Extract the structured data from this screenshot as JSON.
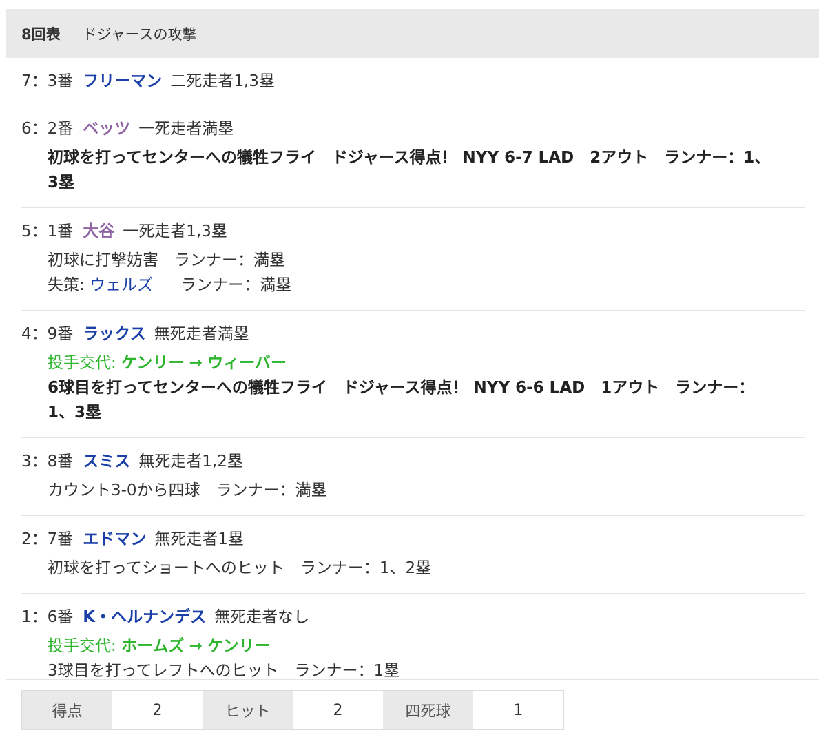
{
  "header": {
    "inning": "8回表",
    "attack": "ドジャースの攻撃"
  },
  "colors": {
    "player_blue": "#1a3fa8",
    "player_purple": "#8f63a3",
    "change_green": "#2db52d"
  },
  "plays": [
    {
      "num": "7：3番",
      "name": "フリーマン",
      "situation": "二死走者1,3塁"
    },
    {
      "num": "6：2番",
      "name": "ベッツ",
      "situation": "一死走者満塁",
      "result_line1": "初球を打ってセンターへの犠牲フライ　ドジャース得点！ NYY 6-7 LAD　2アウト　ランナー：1、",
      "result_line2": "3塁"
    },
    {
      "num": "5：1番",
      "name": "大谷",
      "situation": "一死走者1,3塁",
      "result": "初球に打撃妨害　ランナー：満塁",
      "error_prefix": "失策: ",
      "error_player": "ウェルズ",
      "error_runner": "ランナー：満塁"
    },
    {
      "num": "4：9番",
      "name": "ラックス",
      "situation": "無死走者満塁",
      "change_prefix": "投手交代: ",
      "change_from": "ケンリー",
      "change_arrow": " → ",
      "change_to": "ウィーバー",
      "result_line1": "6球目を打ってセンターへの犠牲フライ　ドジャース得点！ NYY 6-6 LAD　1アウト　ランナー：",
      "result_line2": "1、3塁"
    },
    {
      "num": "3：8番",
      "name": "スミス",
      "situation": "無死走者1,2塁",
      "result": "カウント3-0から四球　ランナー：満塁"
    },
    {
      "num": "2：7番",
      "name": "エドマン",
      "situation": "無死走者1塁",
      "result": "初球を打ってショートへのヒット　ランナー：1、2塁"
    },
    {
      "num": "1：6番",
      "name": "K・ヘルナンデス",
      "situation": "無死走者なし",
      "change_prefix": "投手交代: ",
      "change_from": "ホームズ",
      "change_arrow": " → ",
      "change_to": "ケンリー",
      "result": "3球目を打ってレフトへのヒット　ランナー：1塁"
    }
  ],
  "summary": {
    "runs_label": "得点",
    "runs": "2",
    "hits_label": "ヒット",
    "hits": "2",
    "walks_label": "四死球",
    "walks": "1"
  }
}
